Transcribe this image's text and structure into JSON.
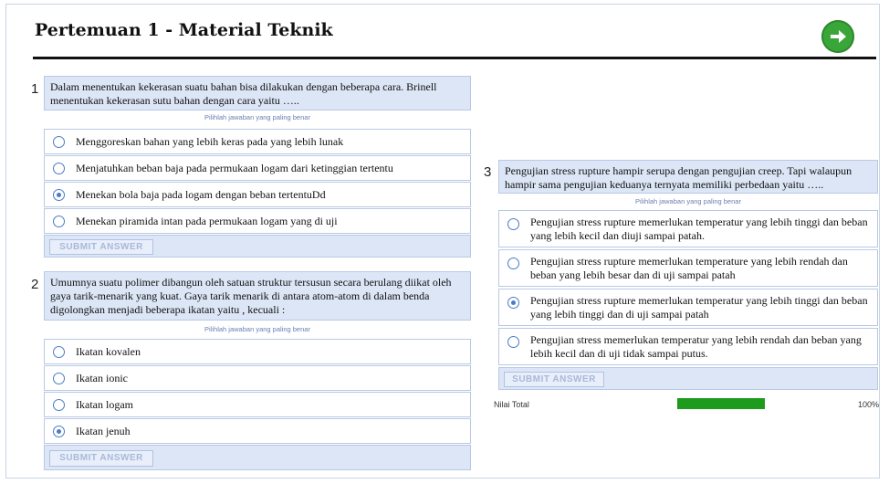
{
  "page": {
    "title": "Pertemuan 1 - Material Teknik",
    "next_icon": "arrow-right-circle-icon",
    "colors": {
      "accent": "#3aa63a",
      "question_bg": "#dce6f6",
      "border": "#b9c9e4",
      "progress": "#1c9b1c"
    }
  },
  "questions": [
    {
      "number": "1",
      "text": "Dalam menentukan kekerasan suatu bahan bisa dilakukan dengan beberapa cara. Brinell menentukan kekerasan sutu bahan dengan cara yaitu …..",
      "hint": "Pilihlah jawaban yang paling benar",
      "options": [
        {
          "label": "Menggoreskan bahan yang lebih keras pada yang lebih lunak",
          "selected": false
        },
        {
          "label": "Menjatuhkan beban baja pada permukaan logam dari ketinggian tertentu",
          "selected": false
        },
        {
          "label": "Menekan bola baja pada logam dengan beban tertentuDd",
          "selected": true
        },
        {
          "label": "Menekan piramida intan pada permukaan logam yang di uji",
          "selected": false
        }
      ],
      "submit_label": "SUBMIT ANSWER"
    },
    {
      "number": "2",
      "text": "Umumnya suatu polimer dibangun oleh satuan struktur tersusun secara berulang diikat oleh gaya tarik-menarik yang kuat. Gaya tarik menarik di antara atom-atom di dalam benda digolongkan menjadi beberapa ikatan yaitu , kecuali :",
      "hint": "Pilihlah jawaban yang paling benar",
      "options": [
        {
          "label": "Ikatan kovalen",
          "selected": false
        },
        {
          "label": "Ikatan ionic",
          "selected": false
        },
        {
          "label": "Ikatan logam",
          "selected": false
        },
        {
          "label": "Ikatan jenuh",
          "selected": true
        }
      ],
      "submit_label": "SUBMIT ANSWER"
    },
    {
      "number": "3",
      "text": "Pengujian stress rupture  hampir serupa dengan pengujian creep. Tapi walaupun hampir sama pengujian keduanya ternyata memiliki perbedaan yaitu …..",
      "hint": "Pilihlah jawaban yang paling benar",
      "options": [
        {
          "label": "Pengujian stress rupture memerlukan temperatur yang lebih tinggi dan beban yang lebih kecil dan diuji sampai patah.",
          "selected": false
        },
        {
          "label": "Pengujian stress rupture memerlukan temperature yang lebih rendah dan beban yang lebih besar dan di uji sampai patah",
          "selected": false
        },
        {
          "label": "Pengujian stress rupture memerlukan temperatur yang lebih tinggi dan beban yang lebih tinggi dan di uji sampai patah",
          "selected": true
        },
        {
          "label": "Pengujian stress memerlukan temperatur yang lebih rendah dan beban yang lebih kecil dan di uji tidak sampai putus.",
          "selected": false
        }
      ],
      "submit_label": "SUBMIT ANSWER"
    }
  ],
  "score": {
    "label": "Nilai Total",
    "value_text": "100%",
    "progress_fraction": 1.0
  }
}
